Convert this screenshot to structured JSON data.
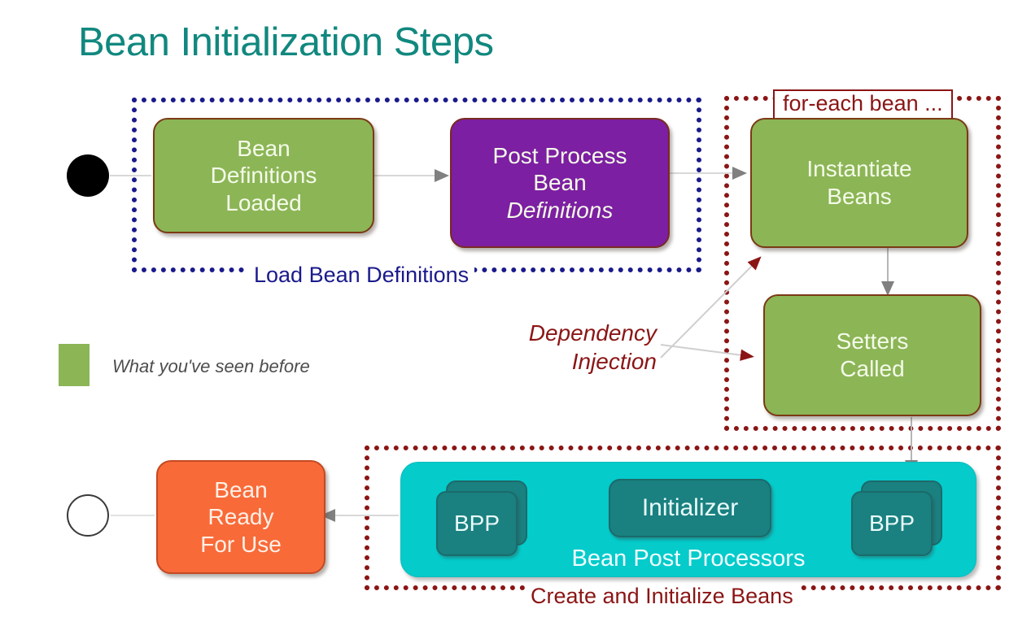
{
  "title": "Bean Initialization Steps",
  "nodes": {
    "bean_definitions_loaded": "Bean\nDefinitions\nLoaded",
    "bean_definitions_loaded_lines": [
      "Bean",
      "Definitions",
      "Loaded"
    ],
    "post_process_line1": "Post Process",
    "post_process_line2": "Bean",
    "post_process_line3": "Definitions",
    "instantiate_line1": "Instantiate",
    "instantiate_line2": "Beans",
    "setters_line1": "Setters",
    "setters_line2": "Called",
    "bean_ready_line1": "Bean",
    "bean_ready_line2": "Ready",
    "bean_ready_line3": "For Use",
    "initializer": "Initializer",
    "bpp_left": "BPP",
    "bpp_right": "BPP"
  },
  "regions": {
    "load_bean_definitions_label": "Load Bean Definitions",
    "for_each_label": "for-each bean ...",
    "create_initialize_label": "Create and Initialize Beans",
    "bean_post_processors_label": "Bean Post Processors"
  },
  "annotations": {
    "dependency_line1": "Dependency",
    "dependency_line2": "Injection"
  },
  "legend": {
    "text": "What you've seen before"
  },
  "colors": {
    "title": "#11887f",
    "green": "#8cb556",
    "purple": "#7c1fa2",
    "orange": "#f96a39",
    "cyan": "#05cbcb",
    "teal": "#1a8080",
    "navy_dash": "#1a1a8c",
    "dark_red": "#8b1515",
    "arrow_gray": "#808080"
  }
}
